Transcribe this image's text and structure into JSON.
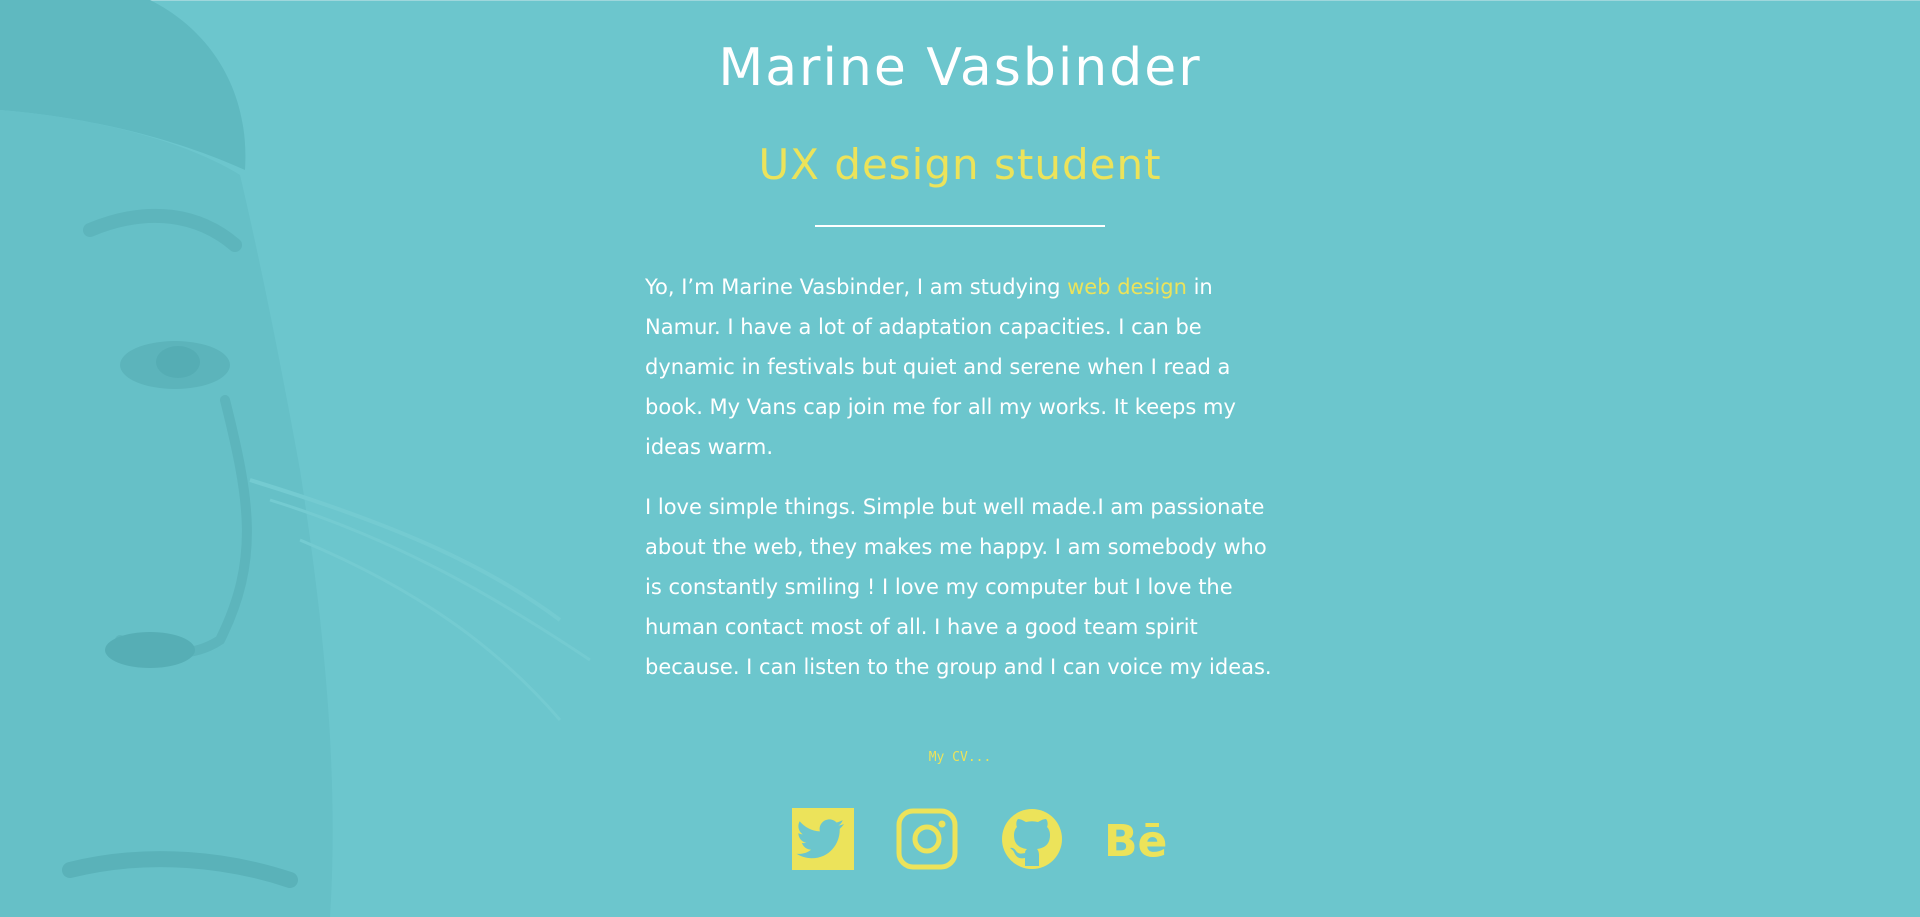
{
  "colors": {
    "background": "#6cc6cd",
    "text": "#ffffff",
    "accent": "#ece35a"
  },
  "header": {
    "title": "Marine Vasbinder",
    "subtitle": "UX design student"
  },
  "bio": {
    "p1_before": "Yo, I’m Marine Vasbinder, I am studying ",
    "p1_link": "web design",
    "p1_after": " in Namur. I have a lot of adaptation capacities. I can be dynamic in festivals but quiet and serene when I read a book. My Vans cap join me for all my works. It keeps my ideas warm.",
    "p2": "I love simple things. Simple but well made.I am passionate about the web, they makes me happy. I am somebody who is constantly smiling ! I love my computer but I love the human contact most of all. I have a good team spirit because. I can listen to the group and I can voice my ideas."
  },
  "cv_link": "My CV...",
  "socials": [
    {
      "name": "twitter",
      "icon": "twitter-icon"
    },
    {
      "name": "instagram",
      "icon": "instagram-icon"
    },
    {
      "name": "github",
      "icon": "github-icon"
    },
    {
      "name": "behance",
      "icon": "behance-icon",
      "glyph": "Bē"
    }
  ]
}
